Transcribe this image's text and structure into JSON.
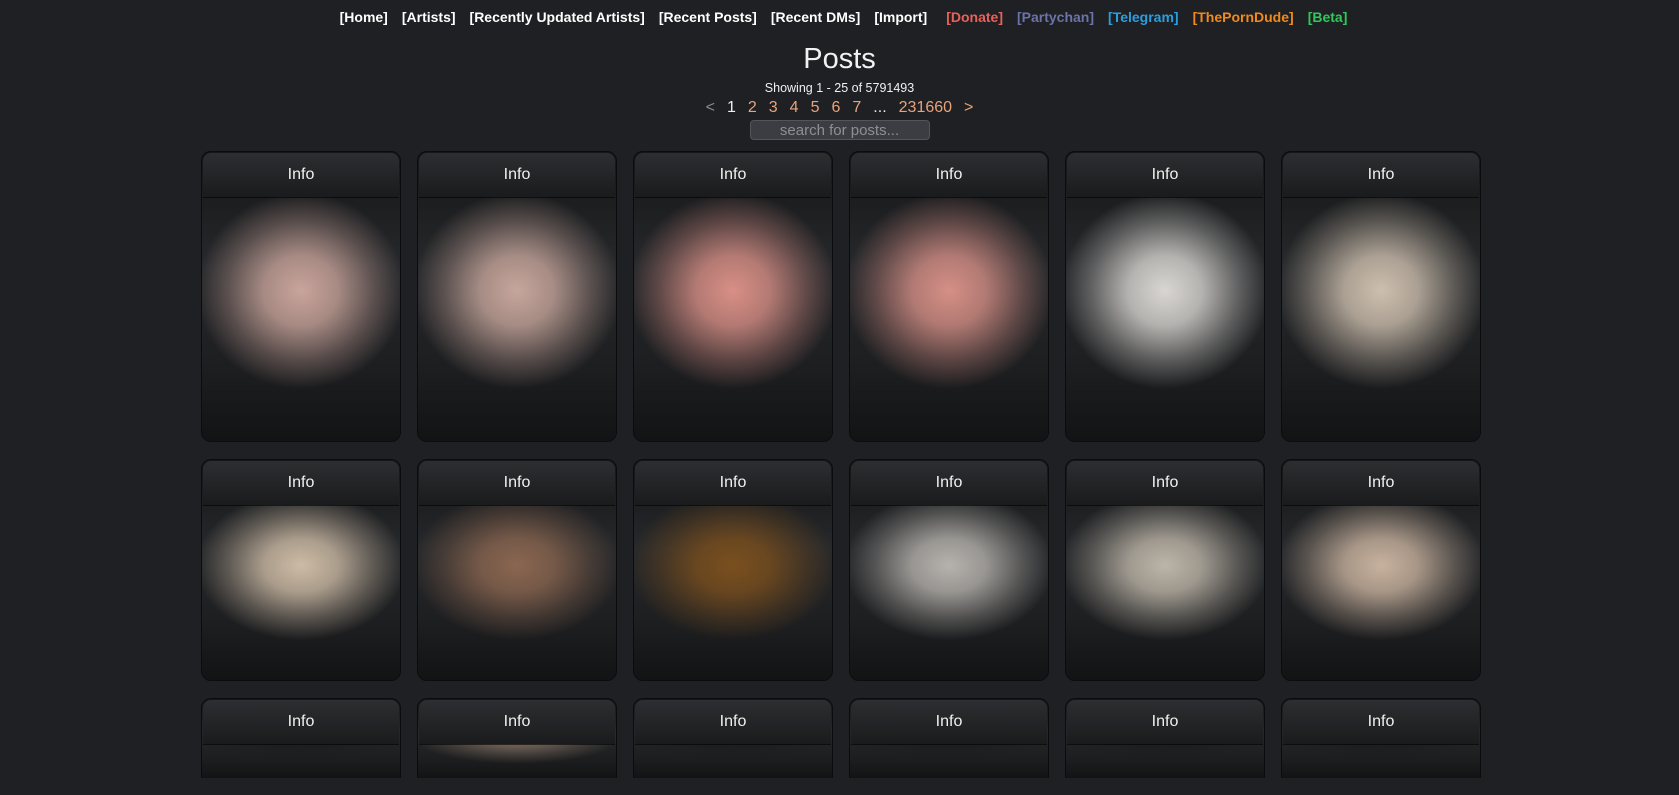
{
  "nav": [
    {
      "label": "[Home]",
      "color": "#ffffff"
    },
    {
      "label": "[Artists]",
      "color": "#ffffff"
    },
    {
      "label": "[Recently Updated Artists]",
      "color": "#ffffff"
    },
    {
      "label": "[Recent Posts]",
      "color": "#ffffff"
    },
    {
      "label": "[Recent DMs]",
      "color": "#ffffff"
    },
    {
      "label": "[Import]",
      "color": "#ffffff"
    },
    {
      "label": "[Donate]",
      "color": "#e8625a"
    },
    {
      "label": "[Partychan]",
      "color": "#6b73a8"
    },
    {
      "label": "[Telegram]",
      "color": "#2a9fe0"
    },
    {
      "label": "[ThePornDude]",
      "color": "#f08a1c"
    },
    {
      "label": "[Beta]",
      "color": "#2ec95a"
    }
  ],
  "page": {
    "title": "Posts",
    "showing": "Showing 1 - 25 of 5791493"
  },
  "pagination": {
    "prev": "<",
    "current": "1",
    "pages": [
      "2",
      "3",
      "4",
      "5",
      "6",
      "7"
    ],
    "ellipsis": "...",
    "last": "231660",
    "next": ">"
  },
  "search": {
    "placeholder": "search for posts..."
  },
  "posts": {
    "info_label": "Info",
    "rows": [
      [
        {
          "tone": "#c9a49b"
        },
        {
          "tone": "#c7a69c"
        },
        {
          "tone": "#d88f86"
        },
        {
          "tone": "#d58f86"
        },
        {
          "tone": "#d9d6d2"
        },
        {
          "tone": "#cdbfae"
        }
      ],
      [
        {
          "tone": "#cdbba5"
        },
        {
          "tone": "#8a6650"
        },
        {
          "tone": "#7a4f1e"
        },
        {
          "tone": "#b6b2ad"
        },
        {
          "tone": "#bdb5a8"
        },
        {
          "tone": "#c8b29e"
        }
      ],
      [
        {
          "tone": "#1c1d1f"
        },
        {
          "tone": "#7a6a5c"
        },
        {
          "tone": "#1c1d1f"
        },
        {
          "tone": "#1c1d1f"
        },
        {
          "tone": "#1c1d1f"
        },
        {
          "tone": "#1c1d1f"
        }
      ]
    ]
  }
}
